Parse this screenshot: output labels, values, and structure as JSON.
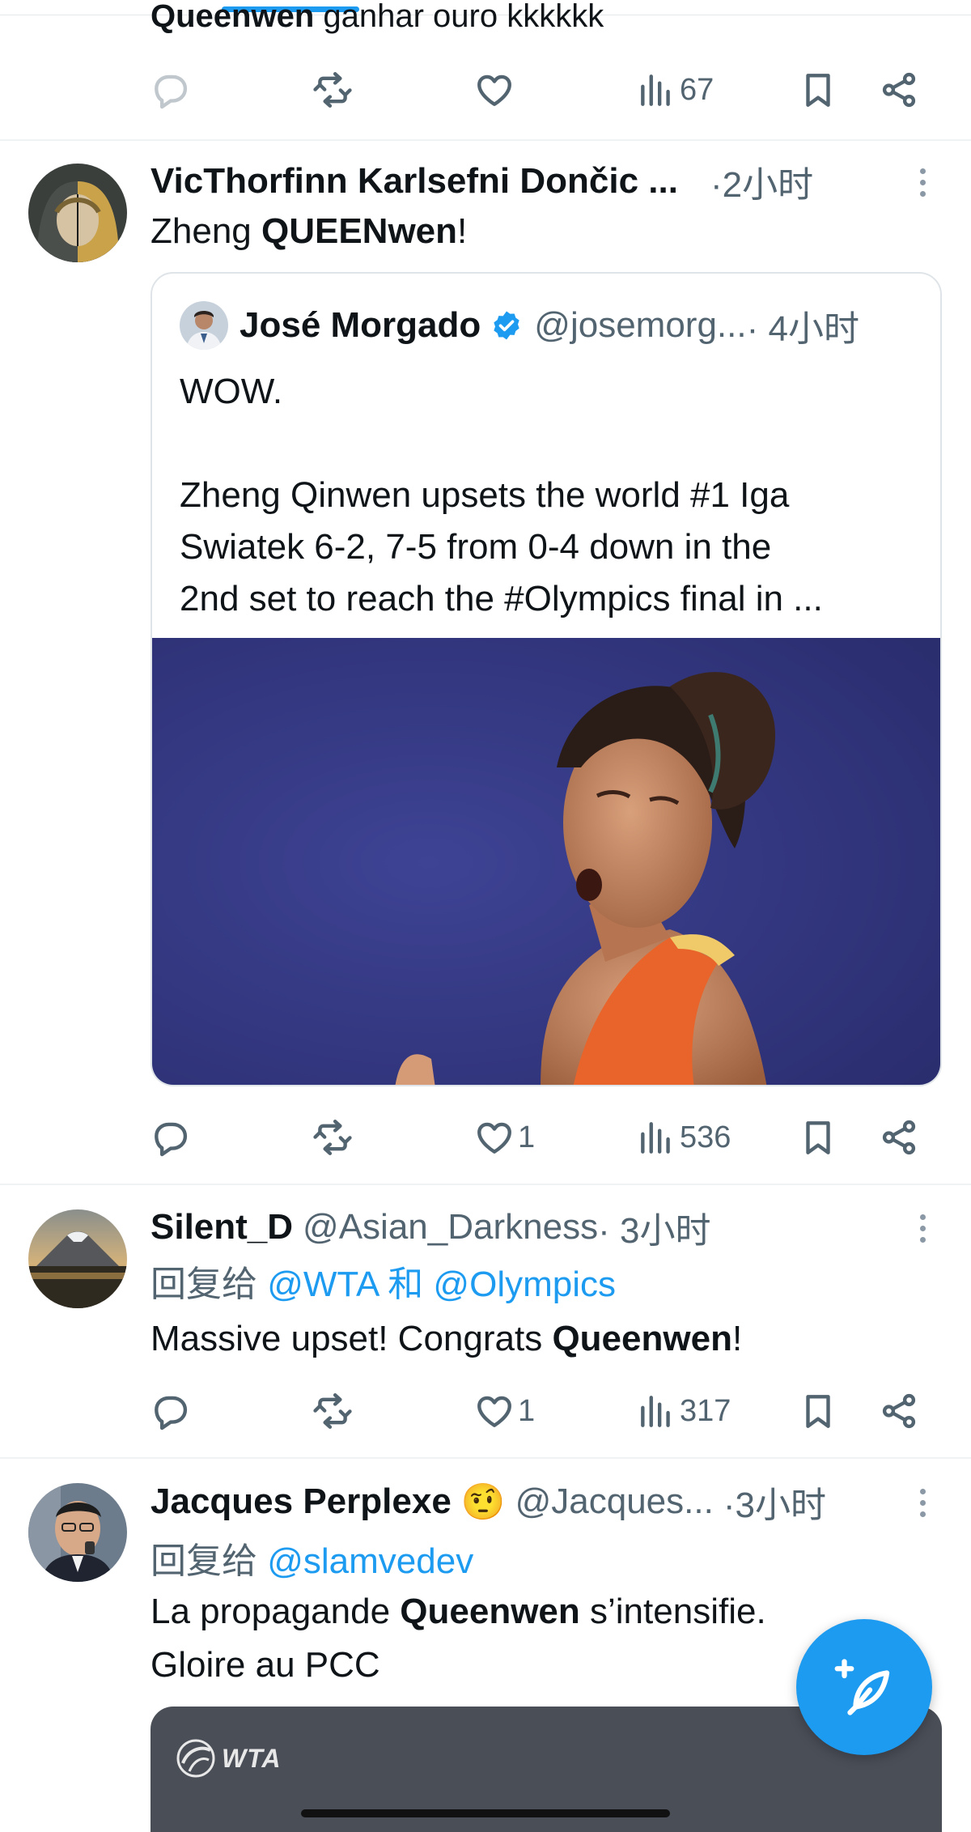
{
  "colors": {
    "accent": "#1d9bf0",
    "text": "#0f1419",
    "muted": "#536471",
    "divider": "#eff3f4"
  },
  "partial_tweet": {
    "text_bold": "Queenwen",
    "text_rest": " ganhar ouro kkkkkk",
    "actions": {
      "views": "67"
    }
  },
  "tweet1": {
    "name": "VicThorfinn Karlsefni Dončic ...",
    "time": "·2小时",
    "text_pre": "Zheng ",
    "text_bold": "QUEENwen",
    "text_post": "!",
    "quote": {
      "name": "José Morgado",
      "handle": "@josemorg...",
      "time": " · 4小时",
      "lines": [
        "WOW.",
        "",
        "Zheng Qinwen upsets the world #1 Iga",
        "Swiatek 6-2, 7-5 from 0-4 down in the",
        "2nd set to reach the #Olympics final in ..."
      ]
    },
    "actions": {
      "likes": "1",
      "views": "536"
    }
  },
  "tweet2": {
    "name": "Silent_D",
    "handle": "@Asian_Darkness",
    "time": " · 3小时",
    "reply_prefix": "回复给 ",
    "reply_mention1": "@WTA",
    "reply_joiner": " 和 ",
    "reply_mention2": "@Olympics",
    "text_pre": "Massive upset! Congrats ",
    "text_bold": "Queenwen",
    "text_post": "!",
    "actions": {
      "likes": "1",
      "views": "317"
    }
  },
  "tweet3": {
    "name": "Jacques Perplexe",
    "emoji": "🤨",
    "handle": "@Jacques...",
    "time": " ·3小时",
    "reply_prefix": "回复给 ",
    "reply_mention": "@slamvedev",
    "line1_pre": "La propagande ",
    "line1_bold": "Queenwen",
    "line1_post": " s’intensifie.",
    "line2": "Gloire au PCC",
    "card_logo": "WTA"
  },
  "icons": [
    "reply-icon",
    "retweet-icon",
    "like-icon",
    "views-icon",
    "bookmark-icon",
    "share-icon",
    "more-icon",
    "verified-icon",
    "compose-icon"
  ]
}
